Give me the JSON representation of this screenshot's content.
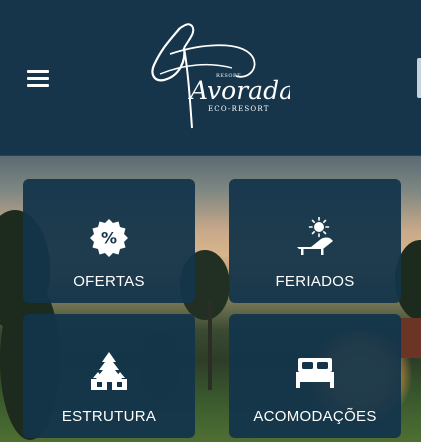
{
  "header": {
    "menu_icon": "hamburger-menu-icon",
    "logo": {
      "small_text": "RESORT",
      "main_text": "Avorada",
      "sub_text": "ECO-RESORT"
    }
  },
  "tiles": [
    {
      "label": "OFERTAS",
      "icon": "percent-badge-icon"
    },
    {
      "label": "FERIADOS",
      "icon": "sun-lounger-icon"
    },
    {
      "label": "ESTRUTURA",
      "icon": "cabin-trees-icon"
    },
    {
      "label": "ACOMODAÇÕES",
      "icon": "bed-icon"
    }
  ],
  "colors": {
    "header_bg": "#16354a",
    "tile_bg": "#13344a",
    "text": "#ffffff"
  }
}
